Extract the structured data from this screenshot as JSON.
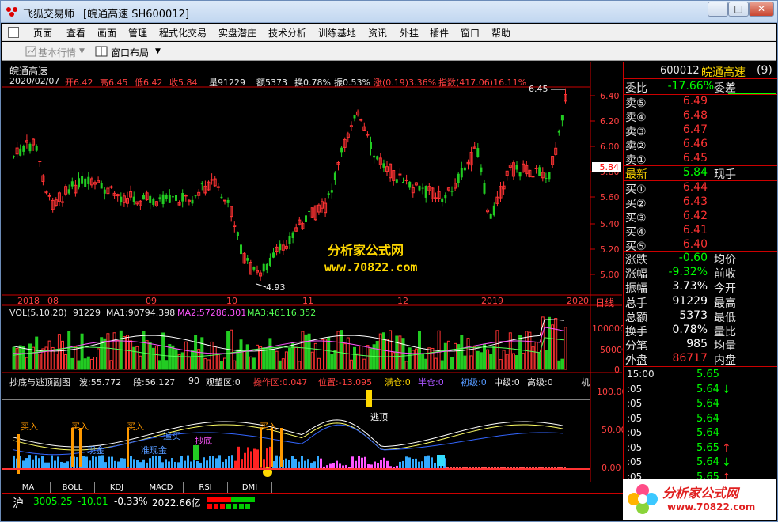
{
  "window": {
    "title": "飞狐交易师",
    "subtitle": "[皖通高速 SH600012]",
    "btn_min": "–",
    "btn_max": "□",
    "btn_close": "✕"
  },
  "menu": [
    "页面",
    "查看",
    "画面",
    "管理",
    "程式化交易",
    "实盘潜庄",
    "技术分析",
    "训练基地",
    "资讯",
    "外挂",
    "插件",
    "窗口",
    "帮助"
  ],
  "toolbar": {
    "basic": "基本行情",
    "layout": "窗口布局"
  },
  "chart": {
    "stock_name": "皖通高速",
    "info_date": "2020/02/07",
    "info_open": "开6.42",
    "info_high": "高6.45",
    "info_low": "低6.42",
    "info_close": "收5.84",
    "info_vol": "量91229",
    "info_amt": "额5373",
    "info_turn": "换0.78%",
    "info_amp": "振0.53%",
    "info_chg": "涨(0.19)3.36%",
    "info_idx": "指数(417.06)16.11%",
    "high_label": "6.45",
    "low_label": "4.93",
    "cur_price": "5.84",
    "price_ticks": [
      "6.40",
      "6.20",
      "6.00",
      "5.80",
      "5.60",
      "5.40",
      "5.20",
      "5.00"
    ],
    "date_ticks": [
      "2018",
      "08",
      "09",
      "10",
      "11",
      "12",
      "2019",
      "2020"
    ],
    "period_label": "日线",
    "watermark1": "分析家公式网",
    "watermark2": "www.70822.com"
  },
  "vol": {
    "label": "VOL(5,10,20)",
    "val": "91229",
    "ma1": "MA1:90794.398",
    "ma2": "MA2:57286.301",
    "ma3": "MA3:46116.352",
    "ticks": [
      "100000",
      "50000",
      "0"
    ],
    "colors": {
      "ma1": "#ffffff",
      "ma2": "#ff55ff",
      "ma3": "#55ff55"
    }
  },
  "ind": {
    "name": "抄底与逃顶副图",
    "wave": "波:55.772",
    "seg": "段:56.127",
    "v90": "90",
    "watch": "观望区:0",
    "op": "操作区:0.047",
    "pos": "位置:-13.095",
    "full": "满仓:0",
    "half": "半仓:0",
    "junior": "初级:0",
    "mid": "中级:0",
    "senior": "高级:0",
    "tail": "机",
    "ticks": [
      "100.00",
      "50.00",
      "0.00"
    ],
    "labels": {
      "buy1": "买入",
      "buy2": "买入",
      "buy3": "买入",
      "buy4": "买入",
      "cash1": "现金",
      "cash2": "准现金",
      "chaodi": "抄底",
      "jiami": "追买",
      "taoding": "逃顶"
    }
  },
  "tabs": [
    "MA",
    "BOLL",
    "KDJ",
    "MACD",
    "RSI",
    "DMI"
  ],
  "quote": {
    "code": "600012",
    "name": "皖通高速",
    "count": "(9)",
    "weibi_k": "委比",
    "weibi_v": "-17.66%",
    "weicha_k": "委差",
    "sells": [
      {
        "k": "卖⑤",
        "v": "6.49"
      },
      {
        "k": "卖④",
        "v": "6.48"
      },
      {
        "k": "卖③",
        "v": "6.47"
      },
      {
        "k": "卖②",
        "v": "6.46"
      },
      {
        "k": "卖①",
        "v": "6.45"
      }
    ],
    "last_k": "最新",
    "last_v": "5.84",
    "xianshou": "现手",
    "buys": [
      {
        "k": "买①",
        "v": "6.44"
      },
      {
        "k": "买②",
        "v": "6.43"
      },
      {
        "k": "买③",
        "v": "6.42"
      },
      {
        "k": "买④",
        "v": "6.41"
      },
      {
        "k": "买⑤",
        "v": "6.40"
      }
    ],
    "stats": [
      {
        "k": "涨跌",
        "v": "-0.60",
        "k2": "均价",
        "c": "#00ff00"
      },
      {
        "k": "涨幅",
        "v": "-9.32%",
        "k2": "前收",
        "c": "#00ff00"
      },
      {
        "k": "振幅",
        "v": "3.73%",
        "k2": "今开",
        "c": "#ffffff"
      },
      {
        "k": "总手",
        "v": "91229",
        "k2": "最高",
        "c": "#ffffff"
      },
      {
        "k": "总额",
        "v": "5373",
        "k2": "最低",
        "c": "#ffffff"
      },
      {
        "k": "换手",
        "v": "0.78%",
        "k2": "量比",
        "c": "#ffffff"
      },
      {
        "k": "分笔",
        "v": "985",
        "k2": "均量",
        "c": "#ffffff"
      },
      {
        "k": "外盘",
        "v": "86717",
        "k2": "内盘",
        "c": "#ff3333"
      }
    ],
    "ticks": [
      {
        "t": "15:00",
        "p": "5.65",
        "a": ""
      },
      {
        "t": ":05",
        "p": "5.64",
        "a": "↓"
      },
      {
        "t": ":05",
        "p": "5.64",
        "a": ""
      },
      {
        "t": ":05",
        "p": "5.64",
        "a": ""
      },
      {
        "t": ":05",
        "p": "5.64",
        "a": ""
      },
      {
        "t": ":05",
        "p": "5.65",
        "a": "↑"
      },
      {
        "t": ":05",
        "p": "5.64",
        "a": "↓"
      },
      {
        "t": ":05",
        "p": "5.65",
        "a": "↑"
      }
    ]
  },
  "status": {
    "mkt": "沪",
    "idx": "3005.25",
    "chg": "-10.01",
    "pct": "-0.33%",
    "amt": "2022.66亿"
  },
  "brand": {
    "name": "分析家公式网",
    "url": "www.70822.com"
  }
}
